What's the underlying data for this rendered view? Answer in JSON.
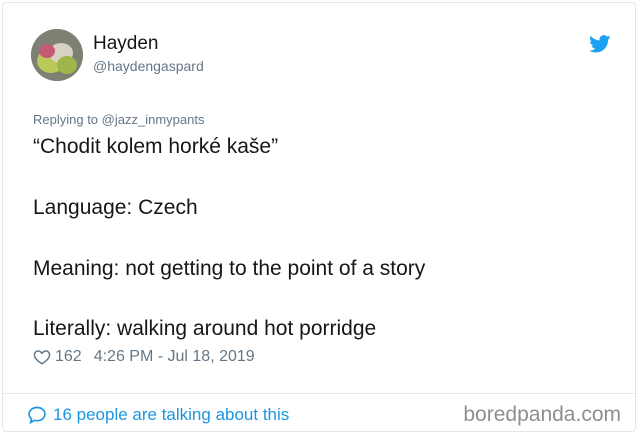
{
  "tweet": {
    "author_name": "Hayden",
    "author_handle": "@haydengaspard",
    "replying_prefix": "Replying to ",
    "replying_to": "@jazz_inmypants",
    "lines": [
      "“Chodit kolem horké kaše”",
      "Language: Czech",
      "Meaning: not getting to the point of a story",
      "Literally: walking around hot porridge"
    ],
    "likes": "162",
    "timestamp": "4:26 PM - Jul 18, 2019",
    "talking": "16 people are talking about this"
  },
  "watermark": "boredpanda.com",
  "colors": {
    "twitter_blue": "#1da1f2",
    "link_blue": "#1b95e0",
    "secondary_gray": "#657786",
    "text_dark": "#14171a",
    "border": "#e1e8ed"
  },
  "icons": {
    "brand": "twitter-bird-icon",
    "like": "heart-icon",
    "conversation": "speech-bubble-icon"
  }
}
